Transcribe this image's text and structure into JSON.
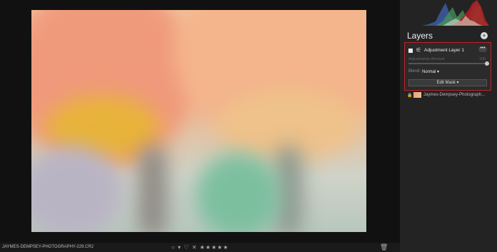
{
  "statusbar": {
    "filename": "JAYMES-DEMPSEY-PHOTOGRAPHY-229.CR2",
    "rating_controls": "○ ▾  ♡  ✕ ★★★★★",
    "trash_icon": "🗑"
  },
  "layers_panel": {
    "title": "Layers",
    "add_button": "+",
    "adjustment_layer": {
      "checked": true,
      "name": "Adjustment Layer 1",
      "menu_label": "•••",
      "amount_label": "Adjustments Amount",
      "amount_value": "100",
      "amount": 100,
      "blend_label": "Blend:",
      "blend_value": "Normal ▾",
      "edit_mask_label": "Edit Mask ▾"
    },
    "photo_layer": {
      "name": "Jaymes-Dempsey-Photograph..."
    }
  },
  "colors": {
    "highlight_border": "#c0222a",
    "panel_bg": "#232323"
  }
}
